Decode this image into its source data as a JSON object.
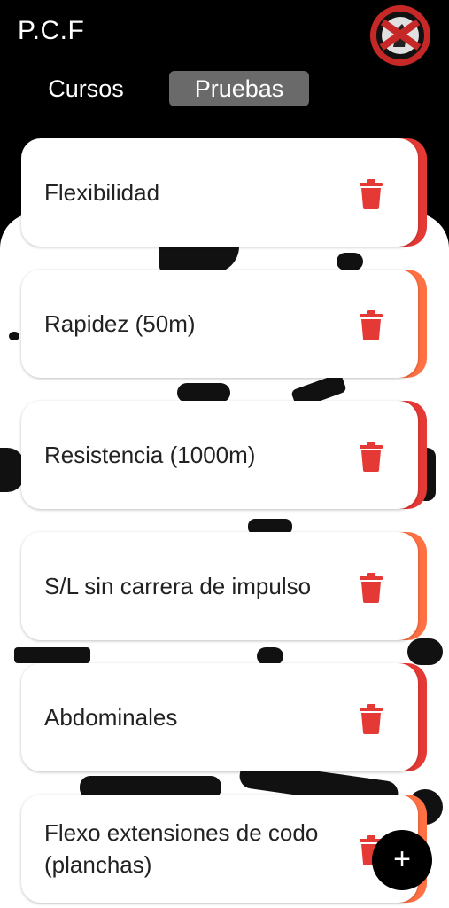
{
  "app": {
    "title": "P.C.F"
  },
  "logo": {
    "icon": "fitness-training-logo-icon"
  },
  "tabs": [
    {
      "label": "Cursos",
      "selected": false
    },
    {
      "label": "Pruebas",
      "selected": true
    }
  ],
  "tests": [
    {
      "label": "Flexibilidad",
      "accent": "#e53935"
    },
    {
      "label": "Rapidez (50m)",
      "accent": "#ff7043"
    },
    {
      "label": "Resistencia (1000m)",
      "accent": "#e53935"
    },
    {
      "label": "S/L sin carrera de impulso",
      "accent": "#ff7043"
    },
    {
      "label": "Abdominales",
      "accent": "#e53935"
    },
    {
      "label": "Flexo extensiones de codo (planchas)",
      "accent": "#ff7043"
    }
  ],
  "delete_icon": "trash-icon",
  "delete_color": "#e53935",
  "fab": {
    "label": "+",
    "icon": "plus-icon"
  }
}
